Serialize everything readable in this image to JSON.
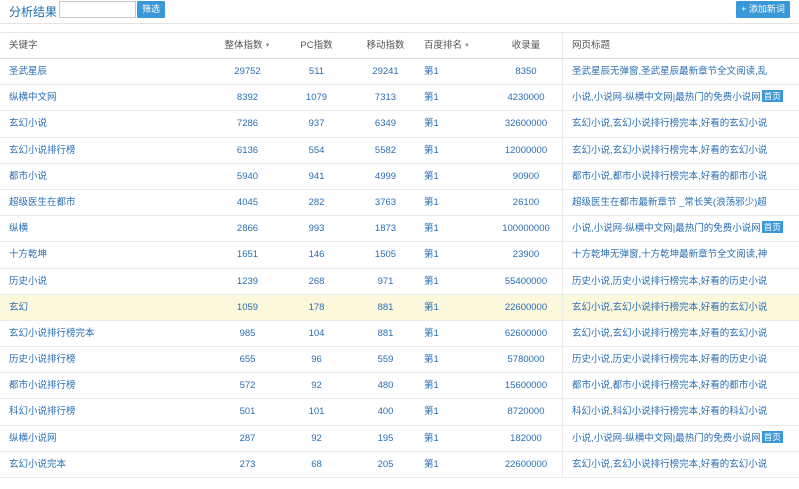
{
  "toolbar": {
    "title": "分析结果",
    "search_value": "",
    "filter_label": "筛选",
    "add_label": "+ 添加新词"
  },
  "table": {
    "headers": {
      "keyword": "关键字",
      "total_index": "整体指数",
      "pc_index": "PC指数",
      "mobile_index": "移动指数",
      "baidu_rank": "百度排名",
      "indexed": "收录量",
      "page_title": "网页标题"
    },
    "rows": [
      {
        "keyword": "圣武星辰",
        "total": "29752",
        "pc": "511",
        "mobile": "29241",
        "rank": "第1",
        "indexed": "8350",
        "page_title": "圣武星辰无弹窗,圣武星辰最新章节全文阅读,乱",
        "badge": ""
      },
      {
        "keyword": "纵横中文网",
        "total": "8392",
        "pc": "1079",
        "mobile": "7313",
        "rank": "第1",
        "indexed": "4230000",
        "page_title": "小说,小说网-纵横中文网|最热门的免费小说网",
        "badge": "首页"
      },
      {
        "keyword": "玄幻小说",
        "total": "7286",
        "pc": "937",
        "mobile": "6349",
        "rank": "第1",
        "indexed": "32600000",
        "page_title": "玄幻小说,玄幻小说排行榜完本,好看的玄幻小说",
        "badge": ""
      },
      {
        "keyword": "玄幻小说排行榜",
        "total": "6136",
        "pc": "554",
        "mobile": "5582",
        "rank": "第1",
        "indexed": "12000000",
        "page_title": "玄幻小说,玄幻小说排行榜完本,好看的玄幻小说",
        "badge": ""
      },
      {
        "keyword": "都市小说",
        "total": "5940",
        "pc": "941",
        "mobile": "4999",
        "rank": "第1",
        "indexed": "90900",
        "page_title": "都市小说,都市小说排行榜完本,好看的都市小说",
        "badge": ""
      },
      {
        "keyword": "超级医生在都市",
        "total": "4045",
        "pc": "282",
        "mobile": "3763",
        "rank": "第1",
        "indexed": "26100",
        "page_title": "超级医生在都市最新章节 _常长笑(浪荡邪少)超",
        "badge": ""
      },
      {
        "keyword": "纵横",
        "total": "2866",
        "pc": "993",
        "mobile": "1873",
        "rank": "第1",
        "indexed": "100000000",
        "page_title": "小说,小说网-纵横中文网|最热门的免费小说网",
        "badge": "首页"
      },
      {
        "keyword": "十方乾坤",
        "total": "1651",
        "pc": "146",
        "mobile": "1505",
        "rank": "第1",
        "indexed": "23900",
        "page_title": "十方乾坤无弹窗,十方乾坤最新章节全文阅读,神",
        "badge": ""
      },
      {
        "keyword": "历史小说",
        "total": "1239",
        "pc": "268",
        "mobile": "971",
        "rank": "第1",
        "indexed": "55400000",
        "page_title": "历史小说,历史小说排行榜完本,好看的历史小说",
        "badge": ""
      },
      {
        "keyword": "玄幻",
        "total": "1059",
        "pc": "178",
        "mobile": "881",
        "rank": "第1",
        "indexed": "22600000",
        "page_title": "玄幻小说,玄幻小说排行榜完本,好看的玄幻小说",
        "badge": ""
      },
      {
        "keyword": "玄幻小说排行榜完本",
        "total": "985",
        "pc": "104",
        "mobile": "881",
        "rank": "第1",
        "indexed": "62600000",
        "page_title": "玄幻小说,玄幻小说排行榜完本,好看的玄幻小说",
        "badge": ""
      },
      {
        "keyword": "历史小说排行榜",
        "total": "655",
        "pc": "96",
        "mobile": "559",
        "rank": "第1",
        "indexed": "5780000",
        "page_title": "历史小说,历史小说排行榜完本,好看的历史小说",
        "badge": ""
      },
      {
        "keyword": "都市小说排行榜",
        "total": "572",
        "pc": "92",
        "mobile": "480",
        "rank": "第1",
        "indexed": "15600000",
        "page_title": "都市小说,都市小说排行榜完本,好看的都市小说",
        "badge": ""
      },
      {
        "keyword": "科幻小说排行榜",
        "total": "501",
        "pc": "101",
        "mobile": "400",
        "rank": "第1",
        "indexed": "8720000",
        "page_title": "科幻小说,科幻小说排行榜完本,好看的科幻小说",
        "badge": ""
      },
      {
        "keyword": "纵横小说网",
        "total": "287",
        "pc": "92",
        "mobile": "195",
        "rank": "第1",
        "indexed": "182000",
        "page_title": "小说,小说网-纵横中文网|最热门的免费小说网",
        "badge": "首页"
      },
      {
        "keyword": "玄幻小说完本",
        "total": "273",
        "pc": "68",
        "mobile": "205",
        "rank": "第1",
        "indexed": "22600000",
        "page_title": "玄幻小说,玄幻小说排行榜完本,好看的玄幻小说",
        "badge": ""
      }
    ]
  },
  "colors": {
    "accent": "#3a97d8",
    "link": "#2a6eb5",
    "highlight_row": "#fbf8dc"
  },
  "icons": {
    "sort": "caret-down-icon"
  }
}
